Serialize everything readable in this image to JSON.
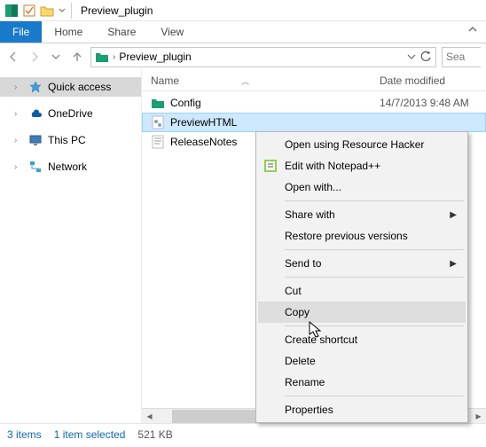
{
  "titlebar": {
    "title": "Preview_plugin"
  },
  "ribbon": {
    "file": "File",
    "home": "Home",
    "share": "Share",
    "view": "View"
  },
  "address": {
    "crumb": "Preview_plugin",
    "search_placeholder": "Sea"
  },
  "navpane": {
    "quick_access": "Quick access",
    "onedrive": "OneDrive",
    "this_pc": "This PC",
    "network": "Network"
  },
  "columns": {
    "name": "Name",
    "date": "Date modified"
  },
  "files": [
    {
      "name": "Config",
      "date": "14/7/2013 9:48 AM",
      "type": "folder"
    },
    {
      "name": "PreviewHTML",
      "date": "",
      "type": "dll"
    },
    {
      "name": "ReleaseNotes",
      "date": "",
      "type": "txt"
    }
  ],
  "context_menu": {
    "open_rh": "Open using Resource Hacker",
    "edit_npp": "Edit with Notepad++",
    "open_with": "Open with...",
    "share_with": "Share with",
    "restore": "Restore previous versions",
    "send_to": "Send to",
    "cut": "Cut",
    "copy": "Copy",
    "shortcut": "Create shortcut",
    "delete": "Delete",
    "rename": "Rename",
    "properties": "Properties"
  },
  "status": {
    "count": "3 items",
    "selected": "1 item selected",
    "size": "521 KB"
  }
}
